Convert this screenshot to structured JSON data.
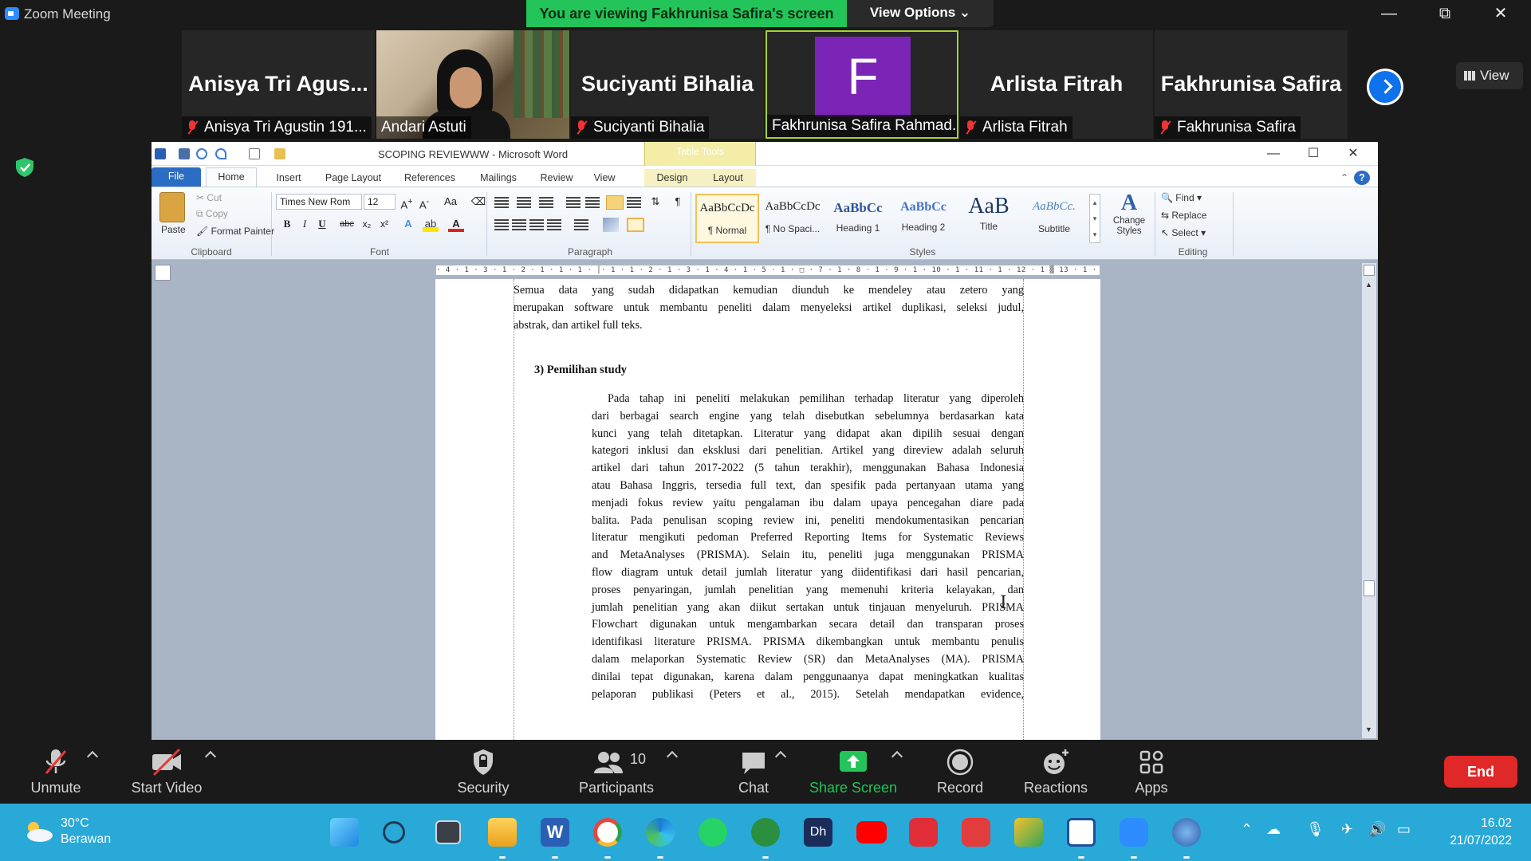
{
  "zoom": {
    "app_title": "Zoom Meeting",
    "banner": "You are viewing Fakhrunisa Safira's screen",
    "view_options": "View Options ⌄",
    "view_button": "View",
    "window_controls": {
      "minimize": "—",
      "restore": "⧉",
      "close": "✕"
    },
    "participants": [
      {
        "big_name": "Anisya  Tri  Agus...",
        "caption": "Anisya Tri Agustin 191...",
        "muted": true
      },
      {
        "big_name": "",
        "caption": "Andari Astuti",
        "muted": false
      },
      {
        "big_name": "Suciyanti Bihalia",
        "caption": "Suciyanti Bihalia",
        "muted": true
      },
      {
        "big_name": "F",
        "caption": "Fakhrunisa Safira Rahmad...",
        "muted": false
      },
      {
        "big_name": "Arlista Fitrah",
        "caption": "Arlista Fitrah",
        "muted": true
      },
      {
        "big_name": "Fakhrunisa Safira",
        "caption": "Fakhrunisa Safira",
        "muted": true
      }
    ],
    "accent_color": "#23c45a",
    "controls": {
      "unmute": "Unmute",
      "start_video": "Start Video",
      "security": "Security",
      "participants": "Participants",
      "participants_count": "10",
      "chat": "Chat",
      "share_screen": "Share Screen",
      "record": "Record",
      "reactions": "Reactions",
      "apps": "Apps",
      "end": "End"
    }
  },
  "word": {
    "window_title": "SCOPING REVIEWWW  -  Microsoft Word",
    "table_tools": "Table Tools",
    "tabs": [
      "File",
      "Home",
      "Insert",
      "Page Layout",
      "References",
      "Mailings",
      "Review",
      "View",
      "Design",
      "Layout"
    ],
    "clipboard": {
      "paste": "Paste",
      "cut": "Cut",
      "copy": "Copy",
      "format_painter": "Format Painter",
      "label": "Clipboard"
    },
    "font": {
      "name": "Times New Rom",
      "size": "12",
      "label": "Font"
    },
    "paragraph_label": "Paragraph",
    "styles": [
      {
        "preview": "AaBbCcDc",
        "name": "¶ Normal"
      },
      {
        "preview": "AaBbCcDc",
        "name": "¶ No Spaci..."
      },
      {
        "preview": "AaBbCc",
        "name": "Heading 1"
      },
      {
        "preview": "AaBbCc",
        "name": "Heading 2"
      },
      {
        "preview": "AaB",
        "name": "Title"
      },
      {
        "preview": "AaBbCc.",
        "name": "Subtitle"
      }
    ],
    "styles_label": "Styles",
    "change_styles": "Change Styles",
    "editing": {
      "find": "Find",
      "replace": "Replace",
      "select": "Select",
      "label": "Editing"
    },
    "ruler_text": "· 4 · 1 · 3 · 1 · 2 · 1 · 1 · 1 · │· 1 · 1 · 2 · 1 · 3 · 1 · 4 · 1 · 5 · 1 · □ · 7 · 1 · 8 · 1 · 9 · 1 · 10 · 1 · 11 · 1 · 12 · 1 ▒ 13 · 1 · 14 · 1 · 15 · 1 · 16 ·",
    "document": {
      "para1": [
        "Semua  data  yang  sudah  didapatkan  kemudian  diunduh  ke  mendeley  atau  zetero  yang",
        "merupakan software untuk membantu peneliti dalam menyeleksi artikel duplikasi, seleksi judul,",
        "abstrak, dan artikel full teks."
      ],
      "heading": "3)  Pemilihan  study",
      "para2": [
        "Pada tahap ini peneliti melakukan pemilihan terhadap literatur yang diperoleh",
        "dari berbagai search engine yang telah disebutkan sebelumnya berdasarkan kata",
        "kunci yang telah ditetapkan. Literatur yang didapat akan dipilih sesuai dengan",
        "kategori inklusi dan eksklusi dari penelitian. Artikel yang direview adalah seluruh",
        "artikel dari tahun 2017-2022 (5 tahun terakhir), menggunakan Bahasa Indonesia",
        "atau Bahasa Inggris, tersedia full text, dan spesifik pada pertanyaan utama yang",
        "menjadi fokus review yaitu pengalaman ibu dalam upaya pencegahan diare pada",
        "balita. Pada penulisan scoping review ini, peneliti mendokumentasikan pencarian",
        "literatur mengikuti pedoman Preferred Reporting Items for Systematic Reviews",
        "and MetaAnalyses (PRISMA). Selain itu, peneliti juga menggunakan PRISMA",
        "flow diagram untuk detail jumlah literatur yang diidentifikasi dari hasil pencarian,",
        "proses penyaringan, jumlah penelitian yang memenuhi kriteria kelayakan, dan",
        "jumlah penelitian yang akan diikut sertakan untuk tinjauan menyeluruh. PRISMA",
        "Flowchart digunakan untuk mengambarkan secara detail dan transparan proses",
        "identifikasi literature PRISMA. PRISMA dikembangkan untuk membantu penulis",
        "dalam melaporkan Systematic Review (SR) dan MetaAnalyses (MA). PRISMA",
        "dinilai tepat digunakan, karena dalam penggunaanya dapat meningkatkan kualitas",
        "pelaporan  publikasi  (Peters  et  al.,  2015).  Setelah  mendapatkan  evidence,"
      ]
    }
  },
  "taskbar": {
    "temp": "30°C",
    "weather": "Berawan",
    "time": "16.02",
    "date": "21/07/2022"
  }
}
